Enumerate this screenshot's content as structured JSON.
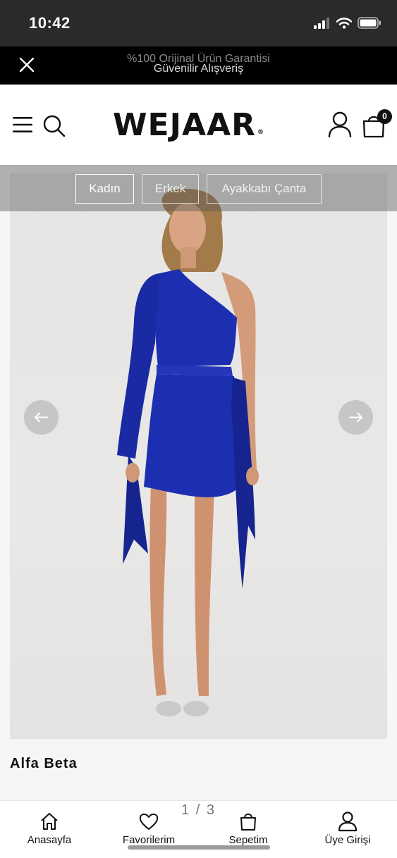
{
  "status_bar": {
    "time": "10:42"
  },
  "announcement": {
    "line1": "%100 Orijinal Ürün Garantisi",
    "line2": "Güvenilir Alışveriş"
  },
  "header": {
    "logo": "WEJAAR",
    "logo_mark": "®",
    "cart_count": "0"
  },
  "categories": [
    {
      "label": "Kadın",
      "active": true
    },
    {
      "label": "Erkek",
      "active": false
    },
    {
      "label": "Ayakkabı Çanta",
      "active": false
    }
  ],
  "product": {
    "name": "Alfa Beta",
    "pager": "1 / 3",
    "dress_color": "#1b2fb0"
  },
  "bottom_nav": [
    {
      "label": "Anasayfa",
      "icon": "home-icon"
    },
    {
      "label": "Favorilerim",
      "icon": "heart-icon"
    },
    {
      "label": "Sepetim",
      "icon": "bag-icon"
    },
    {
      "label": "Üye Girişi",
      "icon": "user-icon"
    }
  ],
  "colors": {
    "accent": "#111111",
    "announcement_bg": "#000000",
    "status_bg": "#2a2a2a"
  }
}
